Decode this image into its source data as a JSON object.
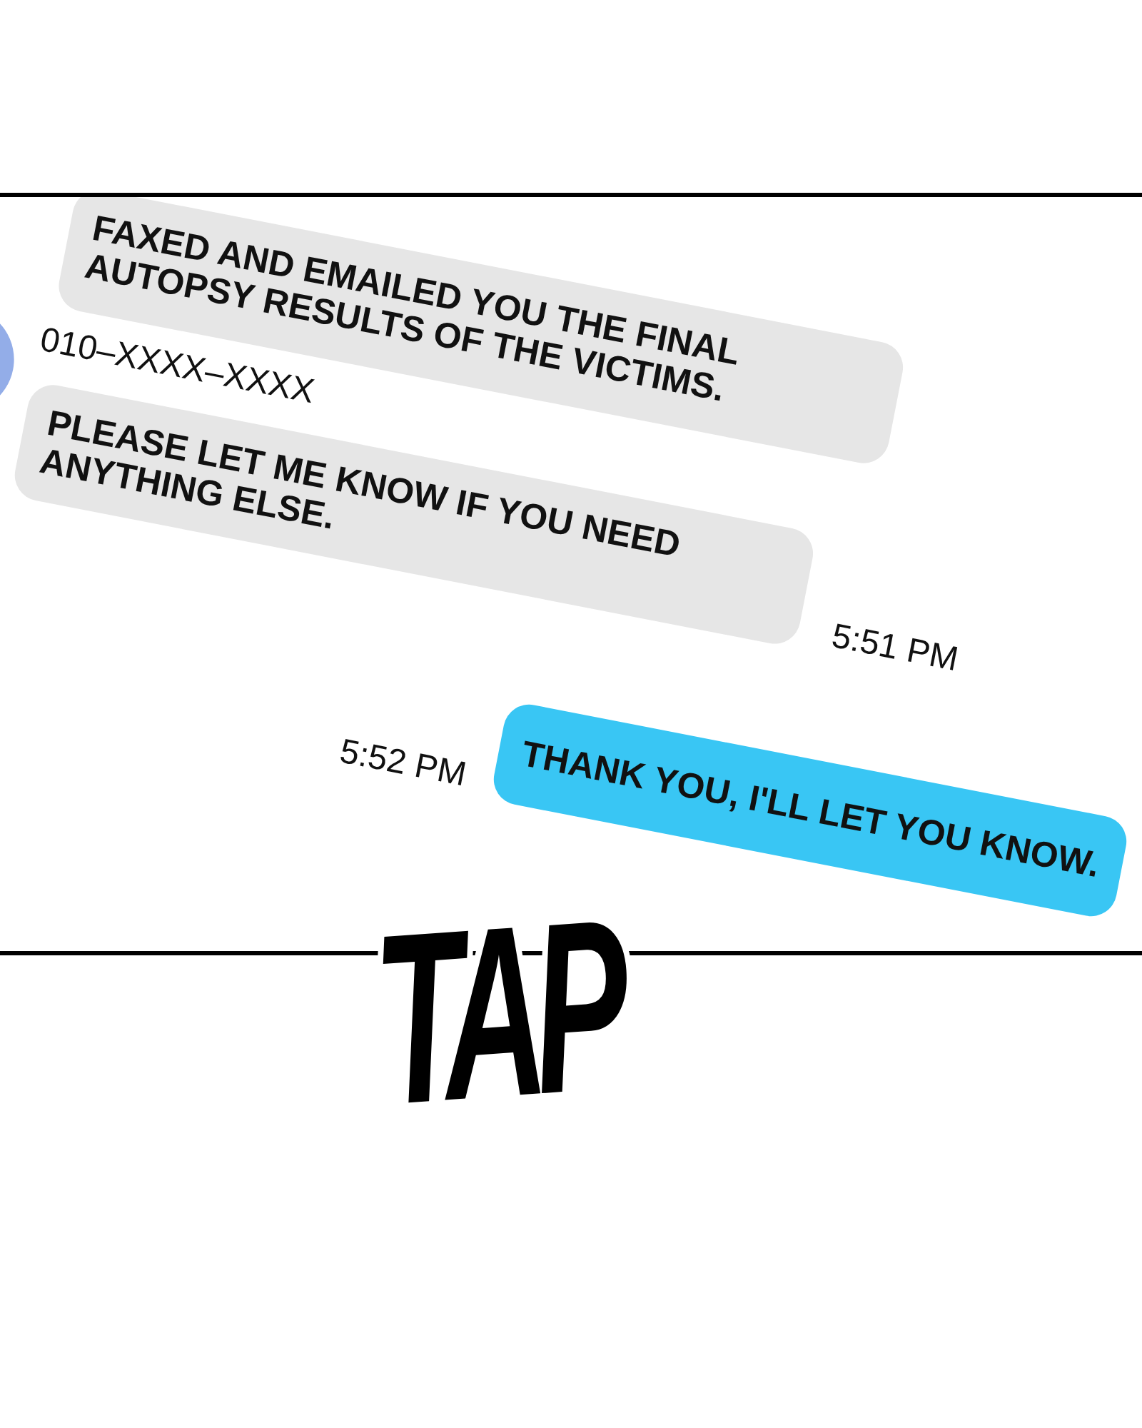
{
  "messages": [
    {
      "kind": "incoming",
      "text": "FAXED AND EMAILED YOU THE FINAL AUTOPSY RESULTS OF THE VICTIMS."
    },
    {
      "kind": "incoming",
      "sender": "010–XXXX–XXXX",
      "text": "PLEASE LET ME KNOW IF YOU NEED ANYTHING ELSE.",
      "time": "5:51 PM"
    },
    {
      "kind": "outgoing",
      "text": "THANK YOU, I'LL LET YOU KNOW.",
      "time": "5:52 PM"
    }
  ],
  "sound_effect": "TAP"
}
